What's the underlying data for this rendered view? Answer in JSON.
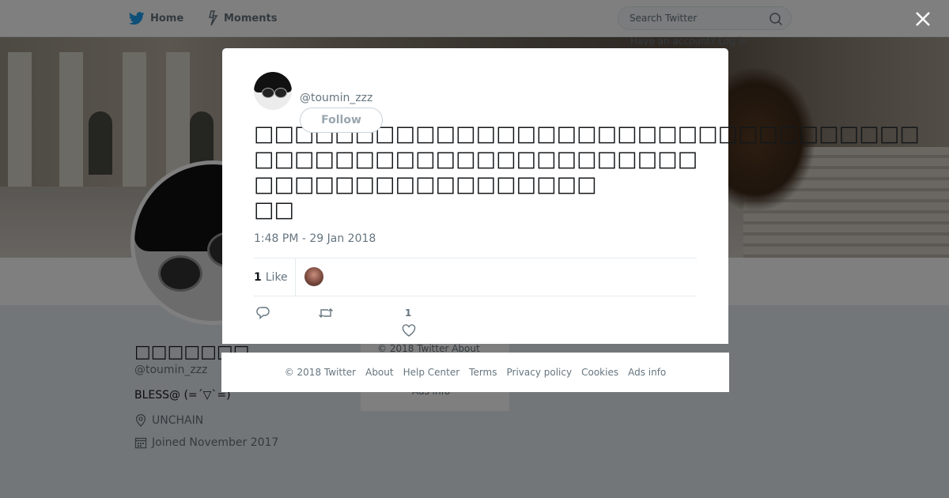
{
  "topbar": {
    "home_label": "Home",
    "moments_label": "Moments",
    "search_placeholder": "Search Twitter",
    "login_hint": "Have an account? Log in"
  },
  "profile": {
    "name": "□□□□□□□",
    "handle": "@toumin_zzz",
    "bio": "BLESS@ (=´▽`=)",
    "location": "UNCHAIN",
    "joined": "Joined November 2017"
  },
  "side_footer": {
    "line1": "© 2018 Twitter   About",
    "line2": "Ads info"
  },
  "tweet": {
    "handle": "@toumin_zzz",
    "follow_label": "Follow",
    "text_lines": [
      "□□□□□□□□□□□□□□□□□□□□□□□□□□□□□□□□□",
      "□□□□□□□□□□□□□□□□□□□□□□",
      "□□□□□□□□□□□□□□□□□",
      "□□"
    ],
    "timestamp": "1:48 PM - 29 Jan 2018",
    "like_count": "1",
    "like_label": "Like",
    "action_like_count": "1"
  },
  "footer": {
    "copyright": "© 2018 Twitter",
    "links": [
      "About",
      "Help Center",
      "Terms",
      "Privacy policy",
      "Cookies",
      "Ads info"
    ]
  },
  "colors": {
    "brand_blue": "#1da1f2",
    "secondary_text": "#66757f",
    "overlay": "rgba(0,0,0,0.5)"
  }
}
